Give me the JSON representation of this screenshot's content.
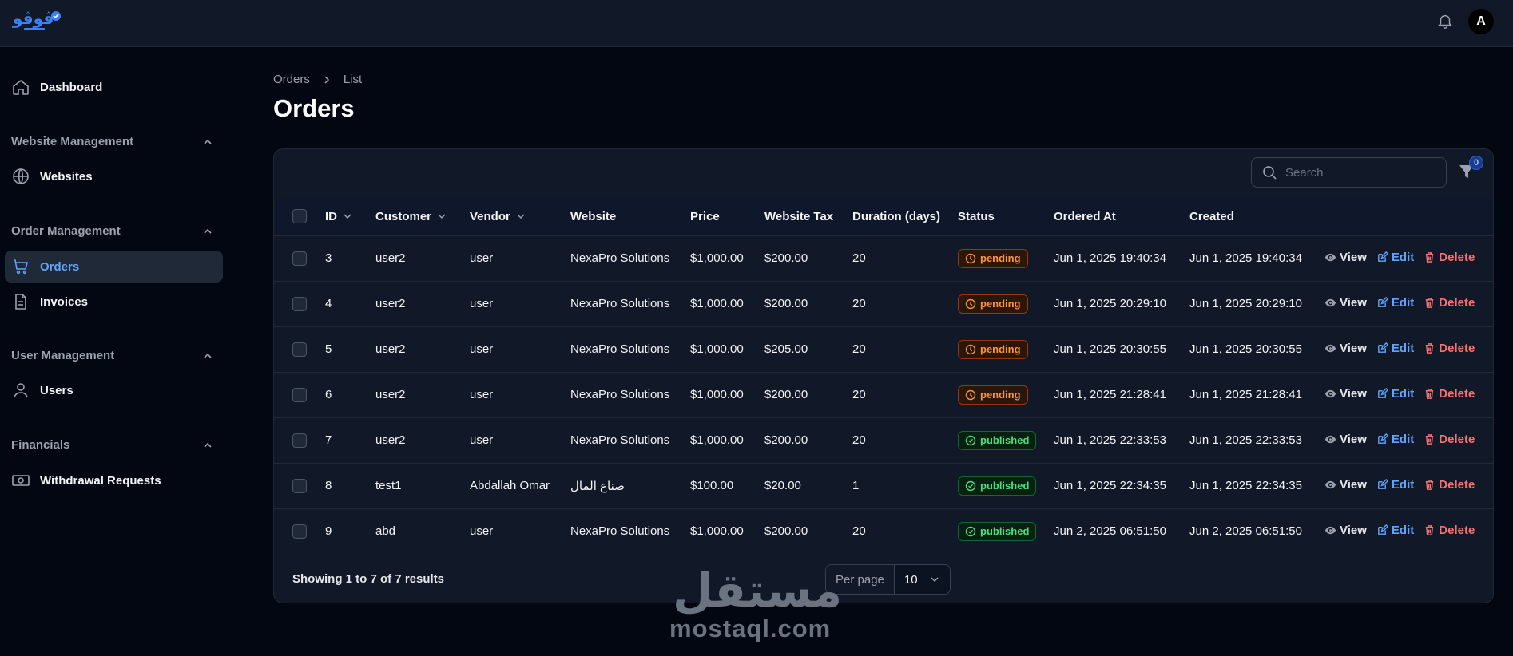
{
  "header": {
    "avatar_initial": "A",
    "accent": "#60a5fa"
  },
  "sidebar": {
    "dashboard": "Dashboard",
    "groups": [
      {
        "label": "Website Management",
        "items": [
          {
            "label": "Websites",
            "icon": "globe-icon"
          }
        ]
      },
      {
        "label": "Order Management",
        "items": [
          {
            "label": "Orders",
            "icon": "cart-icon"
          },
          {
            "label": "Invoices",
            "icon": "document-icon"
          }
        ]
      },
      {
        "label": "User Management",
        "items": [
          {
            "label": "Users",
            "icon": "user-icon"
          }
        ]
      },
      {
        "label": "Financials",
        "items": [
          {
            "label": "Withdrawal Requests",
            "icon": "cash-icon"
          }
        ]
      }
    ],
    "active": "Orders"
  },
  "breadcrumb": {
    "root": "Orders",
    "current": "List"
  },
  "page": {
    "title": "Orders"
  },
  "search": {
    "placeholder": "Search"
  },
  "filter": {
    "count": "0"
  },
  "table": {
    "columns": [
      "ID",
      "Customer",
      "Vendor",
      "Website",
      "Price",
      "Website Tax",
      "Duration (days)",
      "Status",
      "Ordered At",
      "Created"
    ],
    "rows": [
      {
        "id": "3",
        "customer": "user2",
        "vendor": "user",
        "website": "NexaPro Solutions",
        "price": "$1,000.00",
        "tax": "$200.00",
        "duration": "20",
        "status": "pending",
        "ordered_at": "Jun 1, 2025 19:40:34",
        "created": "Jun 1, 2025 19:40:34"
      },
      {
        "id": "4",
        "customer": "user2",
        "vendor": "user",
        "website": "NexaPro Solutions",
        "price": "$1,000.00",
        "tax": "$200.00",
        "duration": "20",
        "status": "pending",
        "ordered_at": "Jun 1, 2025 20:29:10",
        "created": "Jun 1, 2025 20:29:10"
      },
      {
        "id": "5",
        "customer": "user2",
        "vendor": "user",
        "website": "NexaPro Solutions",
        "price": "$1,000.00",
        "tax": "$205.00",
        "duration": "20",
        "status": "pending",
        "ordered_at": "Jun 1, 2025 20:30:55",
        "created": "Jun 1, 2025 20:30:55"
      },
      {
        "id": "6",
        "customer": "user2",
        "vendor": "user",
        "website": "NexaPro Solutions",
        "price": "$1,000.00",
        "tax": "$200.00",
        "duration": "20",
        "status": "pending",
        "ordered_at": "Jun 1, 2025 21:28:41",
        "created": "Jun 1, 2025 21:28:41"
      },
      {
        "id": "7",
        "customer": "user2",
        "vendor": "user",
        "website": "NexaPro Solutions",
        "price": "$1,000.00",
        "tax": "$200.00",
        "duration": "20",
        "status": "published",
        "ordered_at": "Jun 1, 2025 22:33:53",
        "created": "Jun 1, 2025 22:33:53"
      },
      {
        "id": "8",
        "customer": "test1",
        "vendor": "Abdallah Omar",
        "website": "صناع المال",
        "price": "$100.00",
        "tax": "$20.00",
        "duration": "1",
        "status": "published",
        "ordered_at": "Jun 1, 2025 22:34:35",
        "created": "Jun 1, 2025 22:34:35"
      },
      {
        "id": "9",
        "customer": "abd",
        "vendor": "user",
        "website": "NexaPro Solutions",
        "price": "$1,000.00",
        "tax": "$200.00",
        "duration": "20",
        "status": "published",
        "ordered_at": "Jun 2, 2025 06:51:50",
        "created": "Jun 2, 2025 06:51:50"
      }
    ],
    "actions": {
      "view": "View",
      "edit": "Edit",
      "delete": "Delete"
    }
  },
  "footer": {
    "summary": "Showing 1 to 7 of 7 results",
    "per_page_label": "Per page",
    "per_page_value": "10"
  },
  "watermark": {
    "arabic": "مستقل",
    "latin": "mostaql.com"
  }
}
